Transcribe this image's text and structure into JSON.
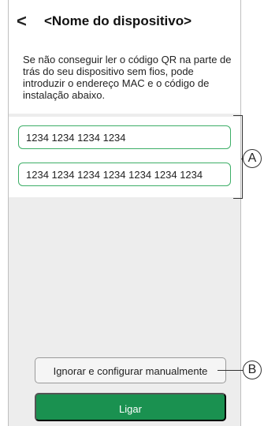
{
  "header": {
    "back_glyph": "<",
    "title": "<Nome do dispositivo>"
  },
  "intro": {
    "text": "Se não conseguir ler o código QR na parte de trás do seu dispositivo sem fios, pode introduzir o endereço MAC e o código de instalação abaixo."
  },
  "fields": {
    "mac_value": "1234 1234 1234 1234",
    "install_code_value": "1234 1234 1234 1234 1234 1234 1234"
  },
  "buttons": {
    "skip_label": "Ignorar e configurar manualmente",
    "connect_label": "Ligar"
  },
  "callouts": {
    "a": "A",
    "b": "B"
  },
  "colors": {
    "accent_green": "#1a9150",
    "field_border": "#3dae67",
    "background": "#ededed"
  },
  "icons": {
    "back": "chevron-left-icon"
  }
}
